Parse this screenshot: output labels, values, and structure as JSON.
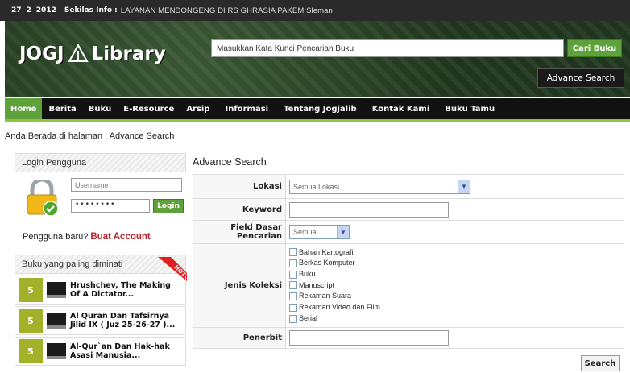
{
  "topbar": {
    "day": "27",
    "month": "2",
    "year": "2012",
    "info_label": "Sekilas Info :",
    "info_text": "LAYANAN MENDONGENG DI RS GHRASIA PAKEM Sleman"
  },
  "header": {
    "logo_left": "JOGJ",
    "logo_right": "Library",
    "search_placeholder": "Masukkan Kata Kunci Pencarian Buku",
    "search_button": "Cari Buku",
    "advance_button": "Advance Search"
  },
  "nav": {
    "items": [
      "Home",
      "Berita",
      "Buku",
      "E-Resource",
      "Arsip",
      "Informasi",
      "Tentang Jogjalib",
      "Kontak Kami",
      "Buku Tamu"
    ],
    "active": "Home"
  },
  "breadcrumb": "Anda Berada di halaman : Advance Search",
  "login": {
    "title": "Login Pengguna",
    "username_placeholder": "Username",
    "password_value": "••••••••",
    "button": "Login",
    "new_user": "Pengguna baru?",
    "create_account": "Buat Account"
  },
  "popular": {
    "title": "Buku yang paling diminati",
    "badge": "HOT",
    "items": [
      {
        "rank": "5",
        "title": "Hrushchev, The Making Of A Dictator..."
      },
      {
        "rank": "5",
        "title": "Al Quran Dan Tafsirnya Jilid IX ( Juz 25-26-27 )..."
      },
      {
        "rank": "5",
        "title": "Al-Qur`an Dan Hak-hak Asasi Manusia..."
      }
    ]
  },
  "advanced": {
    "title": "Advance Search",
    "labels": {
      "lokasi": "Lokasi",
      "keyword": "Keyword",
      "field": "Field Dasar Pencarian",
      "jenis": "Jenis Koleksi",
      "penerbit": "Penerbit"
    },
    "lokasi_value": "Semua Lokasi",
    "field_value": "Semua",
    "jenis_options": [
      "Bahan Kartografi",
      "Berkas Komputer",
      "Buku",
      "Manuscript",
      "Rekaman Suara",
      "Rekaman Video dan Film",
      "Serial"
    ],
    "search_button": "Search"
  },
  "colors": {
    "accent_green": "#5fa23b",
    "nav_bg": "#111111",
    "nav_underline": "#8cc63f",
    "account_red": "#b5202b",
    "rank_olive": "#a3b02a"
  }
}
